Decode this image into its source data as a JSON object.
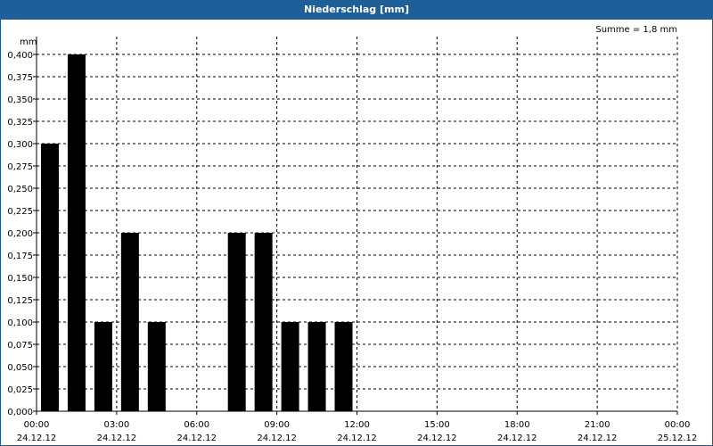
{
  "window": {
    "title": "Niederschlag [mm]"
  },
  "chart_data": {
    "type": "bar",
    "title": "Niederschlag [mm]",
    "ylabel": "mm",
    "annotation": "Summe = 1,8 mm",
    "ylim": [
      0,
      0.4
    ],
    "xlim_hours": [
      0,
      24
    ],
    "y_ticks": [
      "0,000",
      "0,025",
      "0,050",
      "0,075",
      "0,100",
      "0,125",
      "0,150",
      "0,175",
      "0,200",
      "0,225",
      "0,250",
      "0,275",
      "0,300",
      "0,325",
      "0,350",
      "0,375",
      "0,400"
    ],
    "x_ticks": [
      {
        "time": "00:00",
        "date": "24.12.12"
      },
      {
        "time": "03:00",
        "date": "24.12.12"
      },
      {
        "time": "06:00",
        "date": "24.12.12"
      },
      {
        "time": "09:00",
        "date": "24.12.12"
      },
      {
        "time": "12:00",
        "date": "24.12.12"
      },
      {
        "time": "15:00",
        "date": "24.12.12"
      },
      {
        "time": "18:00",
        "date": "24.12.12"
      },
      {
        "time": "21:00",
        "date": "24.12.12"
      },
      {
        "time": "00:00",
        "date": "25.12.12"
      }
    ],
    "series": [
      {
        "color": "#000000",
        "points": [
          {
            "x": "00:30",
            "value": 0.3
          },
          {
            "x": "01:30",
            "value": 0.4
          },
          {
            "x": "02:30",
            "value": 0.1
          },
          {
            "x": "03:30",
            "value": 0.2
          },
          {
            "x": "04:30",
            "value": 0.1
          },
          {
            "x": "07:30",
            "value": 0.2
          },
          {
            "x": "08:30",
            "value": 0.2
          },
          {
            "x": "09:30",
            "value": 0.1
          },
          {
            "x": "10:30",
            "value": 0.1
          },
          {
            "x": "11:30",
            "value": 0.1
          }
        ]
      }
    ],
    "grid": true,
    "legend": "none"
  },
  "colors": {
    "titlebar": "#1f5f97",
    "bars": "#000000",
    "grid": "#000000"
  }
}
